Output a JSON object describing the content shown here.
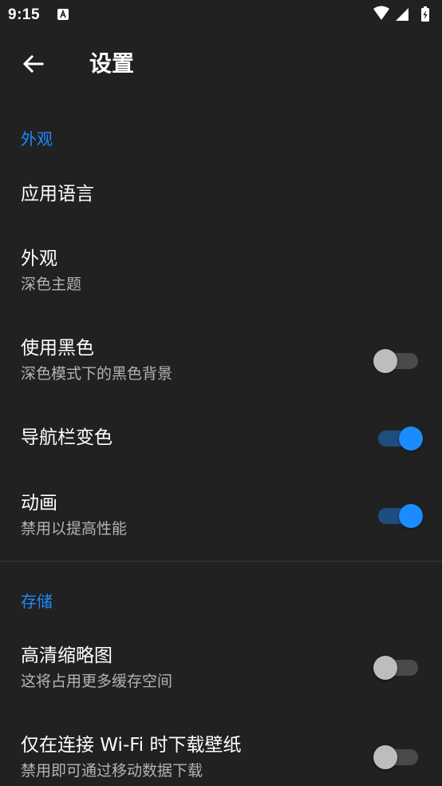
{
  "status_bar": {
    "time": "9:15",
    "icons": [
      "text-a-icon",
      "wifi-icon",
      "signal-icon",
      "battery-charging-icon"
    ]
  },
  "appbar": {
    "back_icon": "arrow-back-icon",
    "title": "设置"
  },
  "sections": [
    {
      "header": "外观",
      "items": [
        {
          "title": "应用语言",
          "subtitle": "",
          "toggle": null
        },
        {
          "title": "外观",
          "subtitle": "深色主题",
          "toggle": null
        },
        {
          "title": "使用黑色",
          "subtitle": "深色模式下的黑色背景",
          "toggle": false
        },
        {
          "title": "导航栏变色",
          "subtitle": "",
          "toggle": true
        },
        {
          "title": "动画",
          "subtitle": "禁用以提高性能",
          "toggle": true
        }
      ]
    },
    {
      "header": "存储",
      "items": [
        {
          "title": "高清缩略图",
          "subtitle": "这将占用更多缓存空间",
          "toggle": false
        },
        {
          "title": "仅在连接 Wi-Fi 时下载壁纸",
          "subtitle": "禁用即可通过移动数据下载",
          "toggle": false
        }
      ]
    }
  ],
  "colors": {
    "background": "#212121",
    "accent": "#1a8cff",
    "secondary_text": "#b3b3b3"
  }
}
